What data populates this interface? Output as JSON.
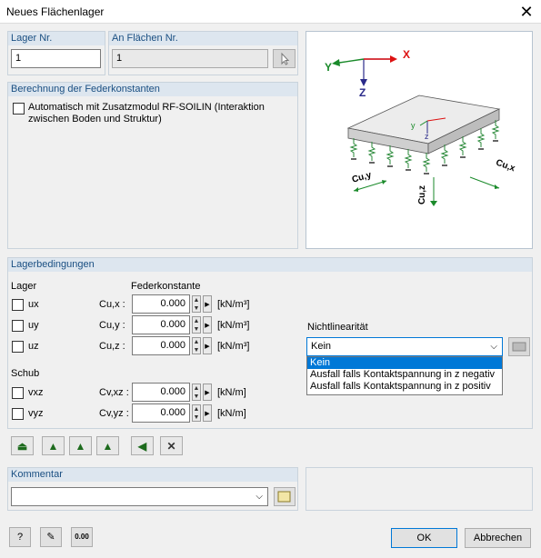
{
  "window": {
    "title": "Neues Flächenlager",
    "close_label": "✕"
  },
  "lager_nr": {
    "label": "Lager Nr.",
    "value": "1"
  },
  "an_flaechen": {
    "label": "An Flächen Nr.",
    "value": "1"
  },
  "federkonstanten": {
    "header": "Berechnung der Federkonstanten",
    "checkbox_label": "Automatisch mit Zusatzmodul RF-SOILIN (Interaktion zwischen Boden und Struktur)"
  },
  "diagram": {
    "axis_x": "X",
    "axis_y": "Y",
    "axis_z": "Z",
    "local_y": "y",
    "local_z": "z",
    "label_cuy": "Cu,y",
    "label_cux": "Cu,x",
    "label_cuz": "Cu,z"
  },
  "lagerbedingungen": {
    "header": "Lagerbedingungen",
    "lager_heading": "Lager",
    "feder_heading": "Federkonstante",
    "rows": [
      {
        "name": "ux",
        "constant": "Cu,x :",
        "value": "0.000",
        "unit": "[kN/m³]"
      },
      {
        "name": "uy",
        "constant": "Cu,y :",
        "value": "0.000",
        "unit": "[kN/m³]"
      },
      {
        "name": "uz",
        "constant": "Cu,z :",
        "value": "0.000",
        "unit": "[kN/m³]"
      }
    ],
    "schub_heading": "Schub",
    "schub_rows": [
      {
        "name": "vxz",
        "constant": "Cv,xz :",
        "value": "0.000",
        "unit": "[kN/m]"
      },
      {
        "name": "vyz",
        "constant": "Cv,yz :",
        "value": "0.000",
        "unit": "[kN/m]"
      }
    ],
    "nichtlinearitaet": {
      "label": "Nichtlinearität",
      "selected": "Kein",
      "options": [
        "Kein",
        "Ausfall falls Kontaktspannung in z negativ",
        "Ausfall falls Kontaktspannung in z positiv"
      ]
    }
  },
  "kommentar": {
    "label": "Kommentar",
    "value": ""
  },
  "footer": {
    "ok_label": "OK",
    "cancel_label": "Abbrechen",
    "zero_icon_text": "0.00"
  }
}
